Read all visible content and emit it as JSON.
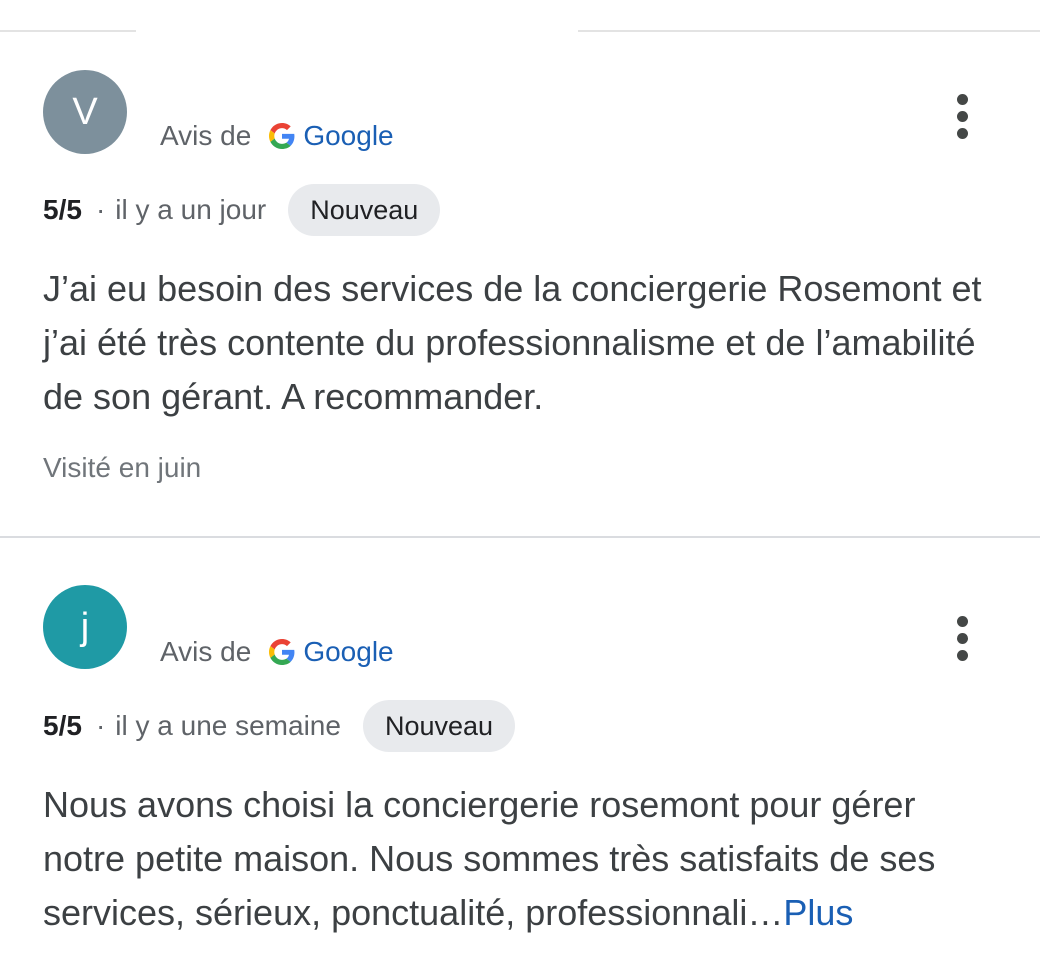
{
  "colors": {
    "avatar_v": "#7d909c",
    "avatar_j": "#1f9aa5",
    "link": "#1a5fb4",
    "badge_bg": "#e8eaed",
    "divider": "#dadce0"
  },
  "icons": {
    "google_logo": "google-g-icon",
    "more_menu": "more-vert-icon"
  },
  "reviews": [
    {
      "avatar_letter": "V",
      "source_prefix": "Avis de",
      "source_brand": "Google",
      "rating": "5/5",
      "separator": "·",
      "time_ago": "il y a un jour",
      "badge": "Nouveau",
      "text": "J’ai eu besoin des services de la conciergerie Rosemont et j’ai été très contente du professionnalisme et de l’amabilité de son gérant. A recommander.",
      "visited": "Visité en juin"
    },
    {
      "avatar_letter": "j",
      "source_prefix": "Avis de",
      "source_brand": "Google",
      "rating": "5/5",
      "separator": "·",
      "time_ago": "il y a une semaine",
      "badge": "Nouveau",
      "text": "Nous avons choisi la conciergerie rosemont pour gérer notre petite maison. Nous sommes très satisfaits de ses services, sérieux, ponctualité, professionnali…",
      "more_label": "Plus"
    }
  ]
}
